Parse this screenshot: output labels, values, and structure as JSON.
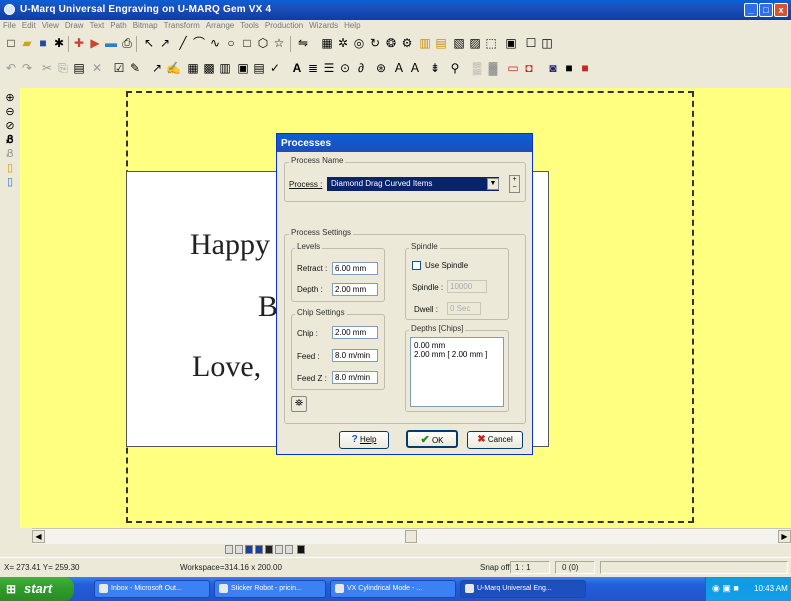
{
  "window": {
    "title": "U-Marq Universal Engraving  on  U-MARQ Gem VX 4"
  },
  "menu": [
    "File",
    "Edit",
    "View",
    "Draw",
    "Text",
    "Path",
    "Bitmap",
    "Transform",
    "Arrange",
    "Tools",
    "Production",
    "Wizards",
    "Help"
  ],
  "canvas": {
    "lines": [
      "Happy",
      "B",
      "Love,"
    ],
    "colors": {
      "background": "#ffff80",
      "plate": "#ffffff"
    }
  },
  "dialog": {
    "title": "Processes",
    "process_name_group": "Process Name",
    "process_label": "Process :",
    "process_value": "Diamond Drag Curved Items",
    "process_settings_group": "Process Settings",
    "levels_group": "Levels",
    "retract_label": "Retract :",
    "retract_value": "6.00 mm",
    "depth_label": "Depth :",
    "depth_value": "2.00 mm",
    "chip_settings_group": "Chip Settings",
    "chip_label": "Chip :",
    "chip_value": "2.00 mm",
    "feed_label": "Feed :",
    "feed_value": "8.0 m/min",
    "feedz_label": "Feed Z :",
    "feedz_value": "8.0 m/min",
    "spindle_group": "Spindle",
    "use_spindle_label": "Use Spindle",
    "spindle_label": "Spindle :",
    "spindle_value": "10000",
    "dwell_label": "Dwell :",
    "dwell_value": "0 Sec",
    "depths_group": "Depths [Chips]",
    "depths_items": [
      "0.00 mm",
      "2.00 mm  [ 2.00 mm ]"
    ],
    "help_label": "Help",
    "ok_label": "OK",
    "cancel_label": "Cancel"
  },
  "status": {
    "coords": "X= 273.41  Y= 259.30",
    "workspace": "Workspace=314.16 x 200.00",
    "snap": "Snap off",
    "ratio": "1 : 1",
    "count": "0 (0)"
  },
  "taskbar": {
    "start_label": "start",
    "tasks": [
      "Inbox - Microsoft Out...",
      "Sticker Robot - pricin...",
      "VX Cylindrical Mode - ...",
      "U-Marq Universal Eng..."
    ],
    "clock": "10:43 AM"
  }
}
